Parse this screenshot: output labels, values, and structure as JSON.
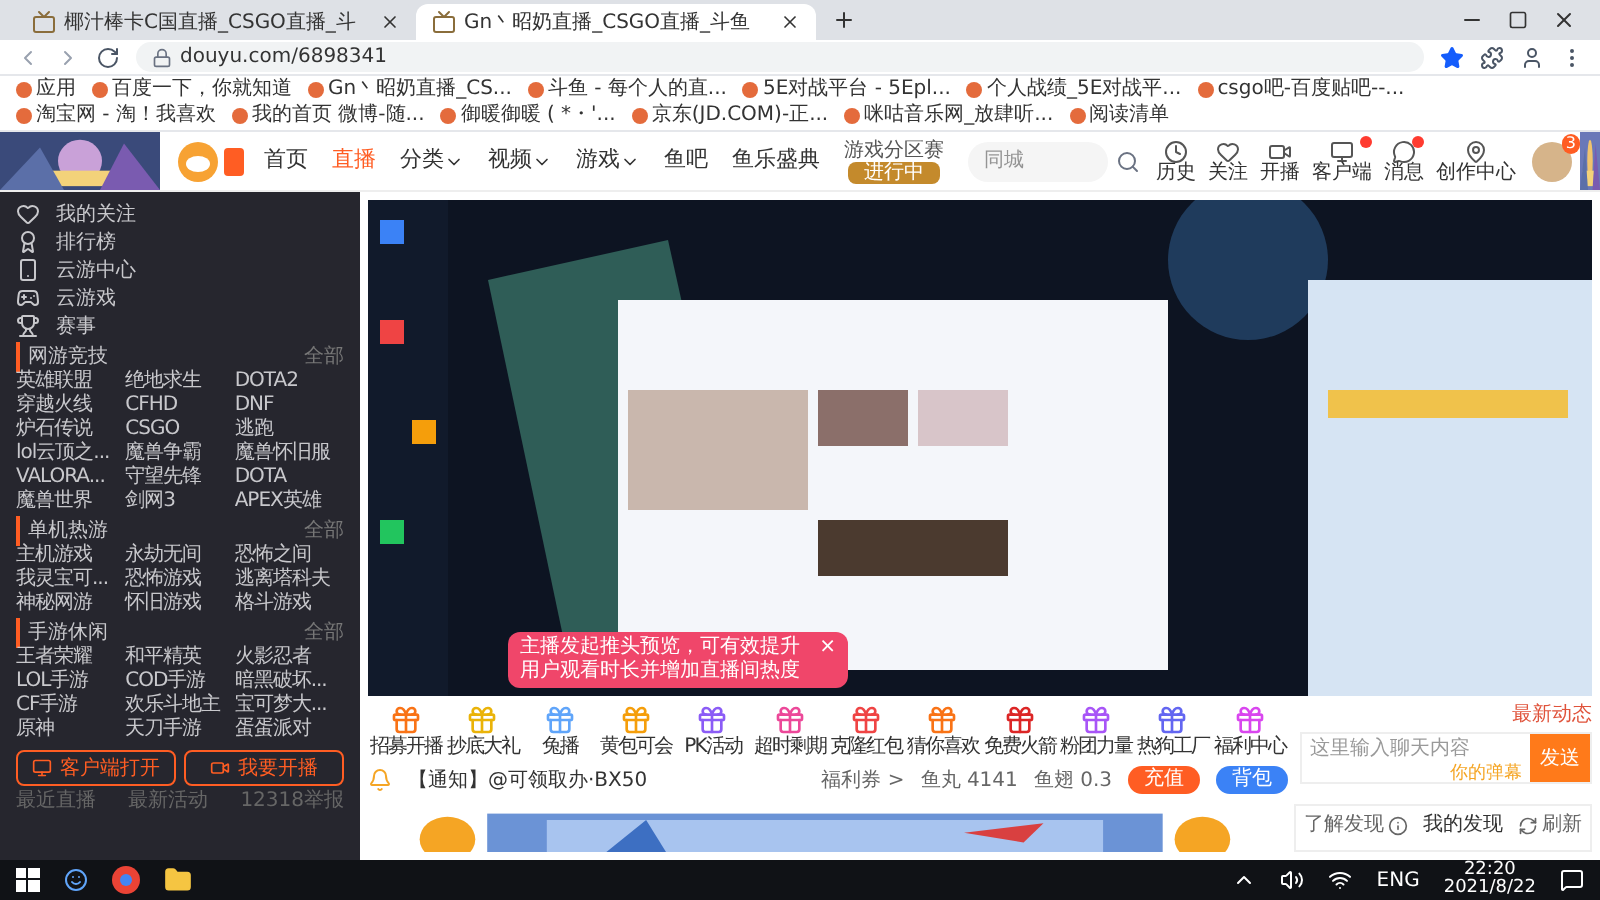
{
  "browser": {
    "tabs": [
      {
        "title": "椰汁棒卡C国直播_CSGO直播_斗",
        "selected": false
      },
      {
        "title": "Gn丶昭奶直播_CSGO直播_斗鱼",
        "selected": true
      }
    ],
    "address": "douyu.com/6898341",
    "bookmarks": [
      "应用",
      "百度一下，你就知道",
      "Gn丶昭奶直播_CS...",
      "斗鱼 - 每个人的直...",
      "5E对战平台 - 5Epl...",
      "个人战绩_5E对战平...",
      "csgo吧-百度贴吧--...",
      "淘宝网 - 淘！我喜欢",
      "我的首页 微博-随...",
      "御暖御暖 ( *・'...",
      "京东(JD.COM)-正...",
      "咪咕音乐网_放肆听...",
      "阅读清单"
    ]
  },
  "header": {
    "nav": [
      {
        "label": "首页",
        "dropdown": false,
        "selected": false
      },
      {
        "label": "直播",
        "dropdown": false,
        "selected": true
      },
      {
        "label": "分类",
        "dropdown": true,
        "selected": false
      },
      {
        "label": "视频",
        "dropdown": true,
        "selected": false
      },
      {
        "label": "游戏",
        "dropdown": true,
        "selected": false
      },
      {
        "label": "鱼吧",
        "dropdown": false,
        "selected": false
      },
      {
        "label": "鱼乐盛典",
        "dropdown": false,
        "selected": false
      }
    ],
    "event_badge": {
      "title": "游戏分区赛",
      "status": "进行中"
    },
    "search": {
      "placeholder": "同城"
    },
    "icons": [
      {
        "label": "历史",
        "dot": false
      },
      {
        "label": "关注",
        "dot": false
      },
      {
        "label": "开播",
        "dot": false
      },
      {
        "label": "客户端",
        "dot": true
      },
      {
        "label": "消息",
        "dot": true
      },
      {
        "label": "创作中心",
        "dot": false
      }
    ],
    "avatar_badge": "3"
  },
  "sidebar": {
    "menu": [
      "我的关注",
      "排行榜",
      "云游中心",
      "云游戏",
      "赛事"
    ],
    "sections": [
      {
        "title": "网游竞技",
        "more": "全部",
        "items": [
          "英雄联盟",
          "绝地求生",
          "DOTA2",
          "穿越火线",
          "CFHD",
          "DNF",
          "炉石传说",
          "CSGO",
          "逃跑",
          "lol云顶之...",
          "魔兽争霸",
          "魔兽怀旧服",
          "VALORA...",
          "守望先锋",
          "DOTA",
          "魔兽世界",
          "剑网3",
          "APEX英雄"
        ]
      },
      {
        "title": "单机热游",
        "more": "全部",
        "items": [
          "主机游戏",
          "永劫无间",
          "恐怖之间",
          "我灵宝可...",
          "恐怖游戏",
          "逃离塔科夫",
          "神秘网游",
          "怀旧游戏",
          "格斗游戏"
        ]
      },
      {
        "title": "手游休闲",
        "more": "全部",
        "items": [
          "王者荣耀",
          "和平精英",
          "火影忍者",
          "LOL手游",
          "COD手游",
          "暗黑破坏...",
          "CF手游",
          "欢乐斗地主",
          "宝可梦大...",
          "原神",
          "天刀手游",
          "蛋蛋派对"
        ]
      }
    ],
    "buttons": [
      "客户端打开",
      "我要开播"
    ],
    "footer": [
      "最近直播",
      "最新活动",
      "12318举报"
    ]
  },
  "toast": {
    "text": "主播发起推头预览，可有效提升用户观看时长并增加直播间热度",
    "close": "×"
  },
  "gifts": [
    "招募开播",
    "抄底大礼",
    "兔播",
    "黄包可会",
    "PK活动",
    "超时剩期",
    "克隆红包",
    "猜你喜欢",
    "免费火箭"
  ],
  "gifts_right": [
    "粉团力量",
    "热狗工厂",
    "福利中心"
  ],
  "notice": "【通知】@可领取办·BX50",
  "wallet": {
    "coupon": "福利券 >",
    "fishball": "鱼丸 4141",
    "fishfin": "鱼翅 0.3",
    "buttons": [
      "充值",
      "背包"
    ]
  },
  "chat": {
    "latest": "最新动态",
    "placeholder": "这里输入聊天内容",
    "danmu": "你的弹幕",
    "send": "发送"
  },
  "discover": {
    "info": "了解发现",
    "title": "我的发现",
    "refresh": "刷新"
  },
  "taskbar": {
    "lang": "ENG",
    "time": "22:20",
    "date": "2021/8/22"
  }
}
